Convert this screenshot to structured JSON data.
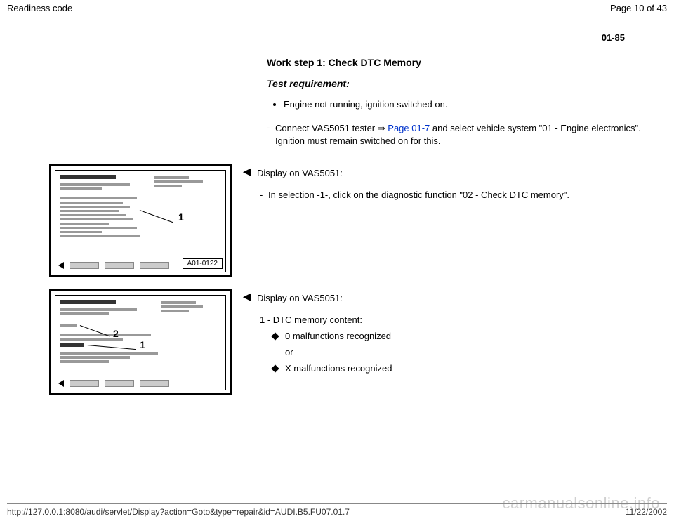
{
  "header": {
    "title": "Readiness code",
    "pagination": "Page 10 of 43"
  },
  "section_code": "01-85",
  "intro": {
    "heading": "Work step 1: Check DTC Memory",
    "subheading": "Test requirement:",
    "bullet": "Engine not running, ignition switched on.",
    "dash_pre": "Connect VAS5051 tester ",
    "dash_arrow": "⇒",
    "dash_link": "Page 01-7",
    "dash_post": " and select vehicle system \"01 - Engine electronics\". Ignition must remain switched on for this."
  },
  "block1": {
    "arrow": "◄",
    "display_label": "Display on VAS5051:",
    "dash_text": "In selection -1-, click on the diagnostic function \"02 - Check DTC memory\".",
    "ref": "A01-0122",
    "callout1": "1"
  },
  "block2": {
    "arrow": "◄",
    "display_label": "Display on VAS5051:",
    "line1": "1 - DTC memory content:",
    "diamond1": "0 malfunctions recognized",
    "or": "or",
    "diamond2": "X malfunctions recognized",
    "callout1": "1",
    "callout2": "2"
  },
  "footer": {
    "url": "http://127.0.0.1:8080/audi/servlet/Display?action=Goto&type=repair&id=AUDI.B5.FU07.01.7",
    "date": "11/22/2002"
  },
  "watermark": "carmanualsonline.info"
}
